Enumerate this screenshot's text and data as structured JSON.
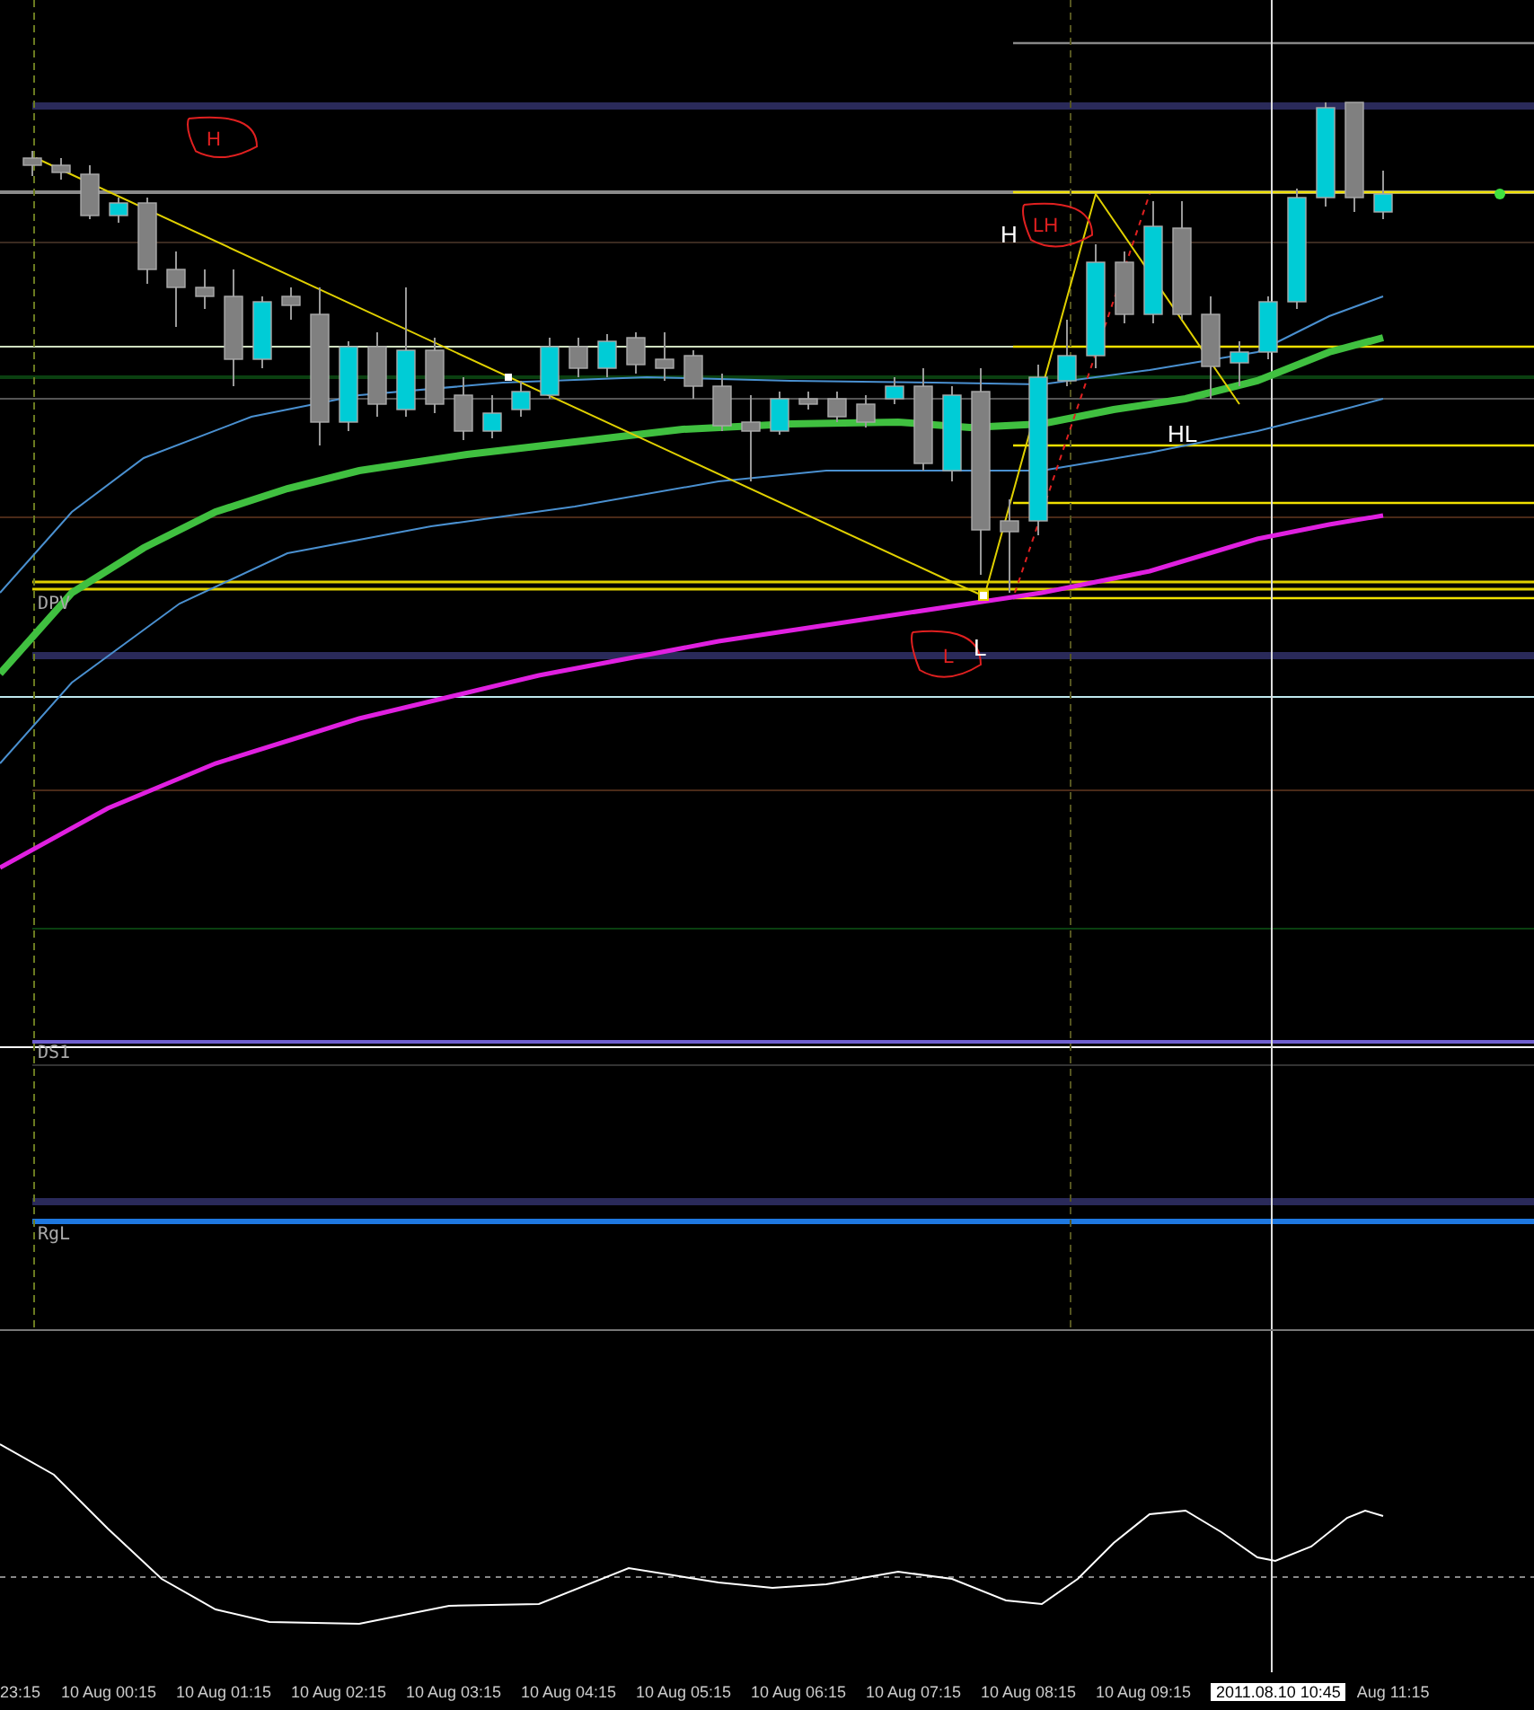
{
  "chart": {
    "level_labels": [
      {
        "text": "DPV"
      },
      {
        "text": "DS1"
      },
      {
        "text": "RgL"
      }
    ],
    "markers": [
      {
        "kind": "hand",
        "text": "H"
      },
      {
        "kind": "hand",
        "text": "LH"
      },
      {
        "kind": "hand",
        "text": "L"
      },
      {
        "kind": "plain",
        "text": "H"
      },
      {
        "kind": "plain",
        "text": "HL"
      },
      {
        "kind": "plain",
        "text": "L"
      }
    ]
  },
  "time_axis": {
    "labels": [
      "23:15",
      "10 Aug 00:15",
      "10 Aug 01:15",
      "10 Aug 02:15",
      "10 Aug 03:15",
      "10 Aug 04:15",
      "10 Aug 05:15",
      "10 Aug 06:15",
      "10 Aug 07:15",
      "10 Aug 08:15",
      "10 Aug 09:15"
    ],
    "cursor_label": "2011.08.10 10:45",
    "end_label": "Aug 11:15"
  }
}
